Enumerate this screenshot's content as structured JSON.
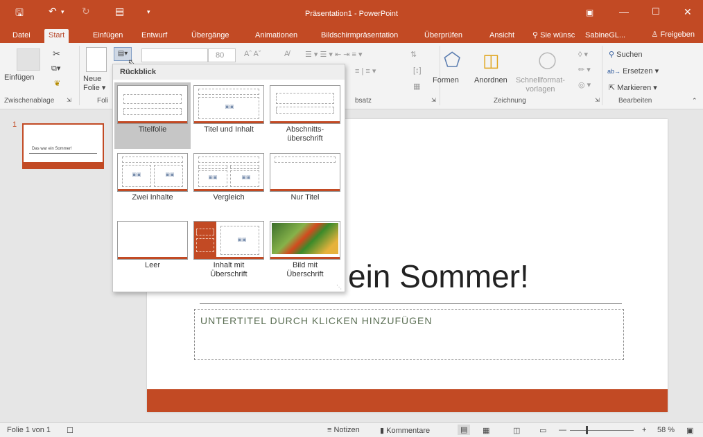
{
  "window": {
    "title": "Präsentation1 - PowerPoint"
  },
  "tabs": {
    "datei": "Datei",
    "start": "Start",
    "einfuegen": "Einfügen",
    "entwurf": "Entwurf",
    "uebergaenge": "Übergänge",
    "animationen": "Animationen",
    "bildschirm": "Bildschirmpräsentation",
    "ueberpruefen": "Überprüfen",
    "ansicht": "Ansicht",
    "tellme": "Sie wünsc",
    "user": "SabineGL...",
    "freigeben": "Freigeben"
  },
  "ribbon": {
    "einfuegen": "Einfügen",
    "zwischenablage": "Zwischenablage",
    "neue_folie_1": "Neue",
    "neue_folie_2": "Folie",
    "folien_group": "Foli",
    "font_size": "80",
    "absatz": "bsatz",
    "formen": "Formen",
    "anordnen": "Anordnen",
    "schnellformat_1": "Schnellformat-",
    "schnellformat_2": "vorlagen",
    "zeichnung": "Zeichnung",
    "suchen": "Suchen",
    "ersetzen": "Ersetzen",
    "markieren": "Markieren",
    "bearbeiten": "Bearbeiten"
  },
  "layout_menu": {
    "header": "Rückblick",
    "items": [
      {
        "name": "Titelfolie"
      },
      {
        "name": "Titel und Inhalt"
      },
      {
        "name": "Abschnitts-überschrift",
        "line1": "Abschnitts-",
        "line2": "überschrift"
      },
      {
        "name": "Zwei Inhalte"
      },
      {
        "name": "Vergleich"
      },
      {
        "name": "Nur Titel"
      },
      {
        "name": "Leer"
      },
      {
        "name": "Inhalt mit Überschrift",
        "line1": "Inhalt mit",
        "line2": "Überschrift"
      },
      {
        "name": "Bild mit Überschrift",
        "line1": "Bild mit",
        "line2": "Überschrift"
      }
    ]
  },
  "thumbnails": {
    "number": "1",
    "text": "Das war ein Sommer!"
  },
  "slide": {
    "title_visible": "ein Sommer!",
    "subtitle_placeholder": "UNTERTITEL DURCH KLICKEN HINZUFÜGEN"
  },
  "status": {
    "slide_info": "Folie 1 von 1",
    "notizen": "Notizen",
    "kommentare": "Kommentare",
    "zoom": "58 %"
  },
  "colors": {
    "accent": "#c24a24"
  }
}
